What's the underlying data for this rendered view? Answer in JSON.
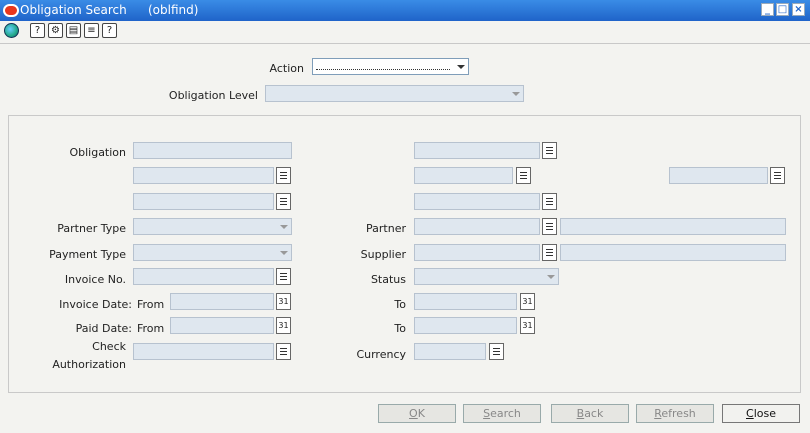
{
  "window": {
    "title": "Obligation Search",
    "form_name": "(oblfind)"
  },
  "toolbar": {
    "icons": [
      "globe-icon",
      "help-icon",
      "tools-icon",
      "clipboard-icon",
      "notes-icon",
      "question-icon"
    ]
  },
  "header": {
    "action_label": "Action",
    "action_value": "",
    "obligation_level_label": "Obligation Level",
    "obligation_level_value": ""
  },
  "criteria": {
    "obligation_label": "Obligation",
    "partner_type_label": "Partner Type",
    "payment_type_label": "Payment Type",
    "invoice_no_label": "Invoice No.",
    "invoice_date_label": "Invoice Date:",
    "from_label": "From",
    "paid_date_label": "Paid Date:",
    "check_label": "Check",
    "authorization_label": "Authorization",
    "partner_label": "Partner",
    "supplier_label": "Supplier",
    "status_label": "Status",
    "to_label": "To",
    "currency_label": "Currency"
  },
  "buttons": {
    "ok": {
      "prefix": "",
      "accel": "O",
      "rest": "K"
    },
    "search": {
      "prefix": "",
      "accel": "S",
      "rest": "earch"
    },
    "back": {
      "prefix": "",
      "accel": "B",
      "rest": "ack"
    },
    "refresh": {
      "prefix": "",
      "accel": "R",
      "rest": "efresh"
    },
    "close": {
      "prefix": "",
      "accel": "C",
      "rest": "lose"
    }
  }
}
